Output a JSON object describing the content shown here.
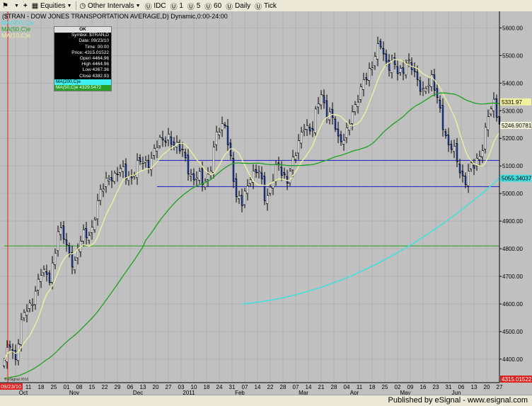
{
  "toolbar": {
    "equities": "Equities",
    "other_intervals": "Other Intervals",
    "idc": "IDC",
    "i1": "1",
    "i5": "5",
    "i60": "60",
    "daily": "Daily",
    "tick": "Tick"
  },
  "chart_title": "($TRAN - DOW JONES TRANSPORTATION AVERAGE,D) Dynamic,0:00-24:00",
  "legend": [
    {
      "label": "MA(200,C)e",
      "color": "#40e0e0"
    },
    {
      "label": "MA(50,C)e",
      "color": "#20a020"
    },
    {
      "label": "MA(10,C)e",
      "color": "#f0f0a0"
    }
  ],
  "price_box": {
    "header": "OK",
    "symbol": "Symbol: $TRAN,D",
    "date": "Date: 09/23/10",
    "time": "Time: 00:00",
    "price": "Price: 4315.01522",
    "open": "Open 4464.96",
    "high": "High 4464.96",
    "low": "Low 4367.36",
    "close": "Close 4382.93",
    "ma200": "MA(200,C)e",
    "ma50": "MA(50,C)e 4329.5472"
  },
  "axis_badges": {
    "ma10": "5331.97",
    "ma50": "5246.90781",
    "ma200": "5055.34037",
    "cursor_price": "4315.01522",
    "cursor_date": "09/23/10"
  },
  "watermark": "© eSignal 2010",
  "status": {
    "published": "Published by eSignal - www.esignal.com"
  },
  "chart_data": {
    "type": "ohlc",
    "title": "($TRAN - DOW JONES TRANSPORTATION AVERAGE,D) Dynamic,0:00-24:00",
    "ylim": [
      4315,
      5660
    ],
    "y_ticks": [
      4400,
      4500,
      4600,
      4700,
      4800,
      4900,
      5000,
      5100,
      5200,
      5300,
      5400,
      5500,
      5600
    ],
    "y_tick_labels": [
      "4400.00",
      "4500.00",
      "4600.00",
      "4700.00",
      "4800.00",
      "4900.00",
      "5000.00",
      "5100.00",
      "5200.00",
      "5300.00",
      "5400.00",
      "5500.00",
      "5600.00"
    ],
    "day_labels": [
      "04",
      "11",
      "18",
      "25",
      "01",
      "08",
      "15",
      "22",
      "29",
      "06",
      "13",
      "20",
      "27",
      "03",
      "10",
      "18",
      "24",
      "31",
      "07",
      "14",
      "22",
      "28",
      "07",
      "14",
      "21",
      "28",
      "04",
      "11",
      "18",
      "25",
      "02",
      "09",
      "16",
      "23",
      "31",
      "06",
      "13",
      "20",
      "27"
    ],
    "month_labels": [
      {
        "label": "Oct",
        "after_day": 0
      },
      {
        "label": "Nov",
        "after_day": 4
      },
      {
        "label": "Dec",
        "after_day": 9
      },
      {
        "label": "2011",
        "after_day": 13
      },
      {
        "label": "Feb",
        "after_day": 17
      },
      {
        "label": "Mar",
        "after_day": 22
      },
      {
        "label": "Apr",
        "after_day": 26
      },
      {
        "label": "May",
        "after_day": 30
      },
      {
        "label": "Jun",
        "after_day": 34
      }
    ],
    "close_keypoints": [
      [
        0,
        4370
      ],
      [
        2,
        4470
      ],
      [
        4,
        4410
      ],
      [
        7,
        4560
      ],
      [
        10,
        4620
      ],
      [
        13,
        4710
      ],
      [
        16,
        4690
      ],
      [
        19,
        4870
      ],
      [
        22,
        4800
      ],
      [
        25,
        4760
      ],
      [
        28,
        4840
      ],
      [
        31,
        4880
      ],
      [
        34,
        5000
      ],
      [
        37,
        5060
      ],
      [
        40,
        5080
      ],
      [
        43,
        5060
      ],
      [
        46,
        5090
      ],
      [
        49,
        5100
      ],
      [
        52,
        5140
      ],
      [
        55,
        5180
      ],
      [
        58,
        5210
      ],
      [
        61,
        5170
      ],
      [
        64,
        5120
      ],
      [
        67,
        5060
      ],
      [
        70,
        5030
      ],
      [
        73,
        5110
      ],
      [
        75,
        5200
      ],
      [
        78,
        5260
      ],
      [
        80,
        5130
      ],
      [
        82,
        4980
      ],
      [
        84,
        4960
      ],
      [
        87,
        5080
      ],
      [
        90,
        5060
      ],
      [
        92,
        5000
      ],
      [
        94,
        5030
      ],
      [
        97,
        5090
      ],
      [
        100,
        5060
      ],
      [
        103,
        5140
      ],
      [
        106,
        5250
      ],
      [
        109,
        5240
      ],
      [
        112,
        5350
      ],
      [
        115,
        5300
      ],
      [
        118,
        5180
      ],
      [
        121,
        5240
      ],
      [
        124,
        5300
      ],
      [
        127,
        5420
      ],
      [
        130,
        5460
      ],
      [
        133,
        5540
      ],
      [
        136,
        5470
      ],
      [
        139,
        5430
      ],
      [
        142,
        5490
      ],
      [
        145,
        5420
      ],
      [
        148,
        5380
      ],
      [
        151,
        5410
      ],
      [
        154,
        5300
      ],
      [
        157,
        5180
      ],
      [
        160,
        5110
      ],
      [
        163,
        5060
      ],
      [
        166,
        5090
      ],
      [
        169,
        5180
      ],
      [
        171,
        5280
      ],
      [
        173,
        5320
      ],
      [
        175,
        5250
      ]
    ],
    "trend_lines": [
      {
        "from": [
          54,
          5120
        ],
        "to": [
          175,
          5120
        ],
        "color": "#1c1cc0"
      },
      {
        "from": [
          54,
          5025
        ],
        "to": [
          175,
          5025
        ],
        "color": "#1c1cc0"
      },
      {
        "from": [
          0,
          4810
        ],
        "to": [
          175,
          4810
        ],
        "color": "#20a020"
      }
    ],
    "series": [
      {
        "name": "MA(10,C)e",
        "color": "#f0f0a0"
      },
      {
        "name": "MA(50,C)e",
        "color": "#20a020"
      },
      {
        "name": "MA(200,C)e",
        "color": "#40e0e0"
      }
    ],
    "grid": true
  }
}
